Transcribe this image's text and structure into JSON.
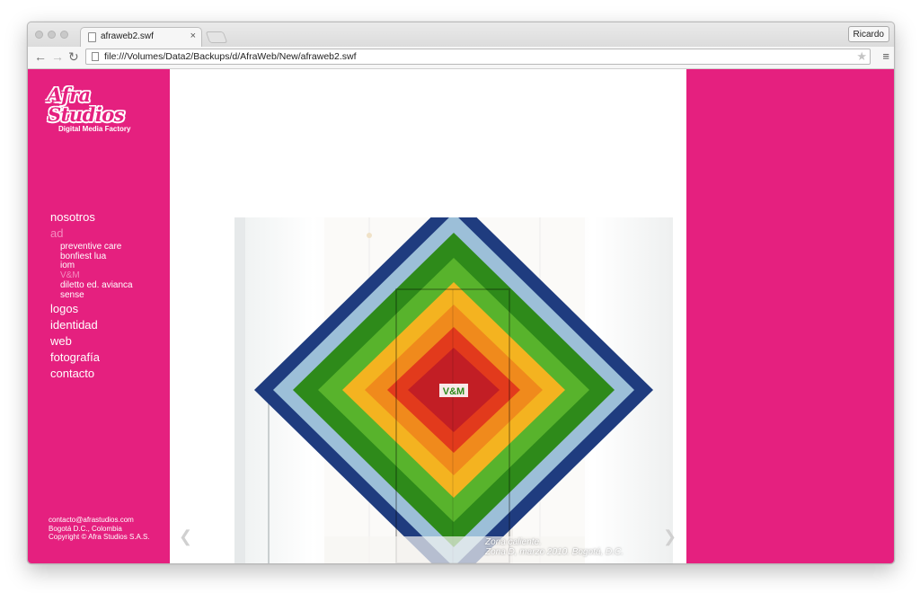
{
  "browser": {
    "tab_title": "afraweb2.swf",
    "tab_close": "×",
    "user_button": "Ricardo",
    "url": "file:///Volumes/Data2/Backups/d/AfraWeb/New/afraweb2.swf",
    "back_icon": "←",
    "forward_icon": "→",
    "reload_icon": "↻",
    "star_icon": "★",
    "menu_icon": "≡"
  },
  "site": {
    "logo_text": "Afra Studios",
    "logo_sub": "Digital Media Factory",
    "nav": {
      "nosotros": "nosotros",
      "ad": "ad",
      "ad_sub": [
        "preventive care",
        "bonfiest lua",
        "iom",
        "V&M",
        "diletto ed. avianca",
        "sense"
      ],
      "logos": "logos",
      "identidad": "identidad",
      "web": "web",
      "fotografia": "fotografía",
      "contacto": "contacto"
    },
    "footer": {
      "email": "contacto@afrastudios.com",
      "city": "Bogotá D.C., Colombia",
      "copyright": "Copyright © Afra Studios S.A.S."
    },
    "gallery": {
      "caption_title": "Zona caliente.",
      "caption_detail": "Zona D, marzo 2010. Bogotá, D.C.",
      "prev_icon": "❮",
      "next_icon": "❯",
      "center_logo": "V&M"
    }
  },
  "colors": {
    "brand_pink": "#e5207f",
    "active_pink": "#f58bbf"
  }
}
